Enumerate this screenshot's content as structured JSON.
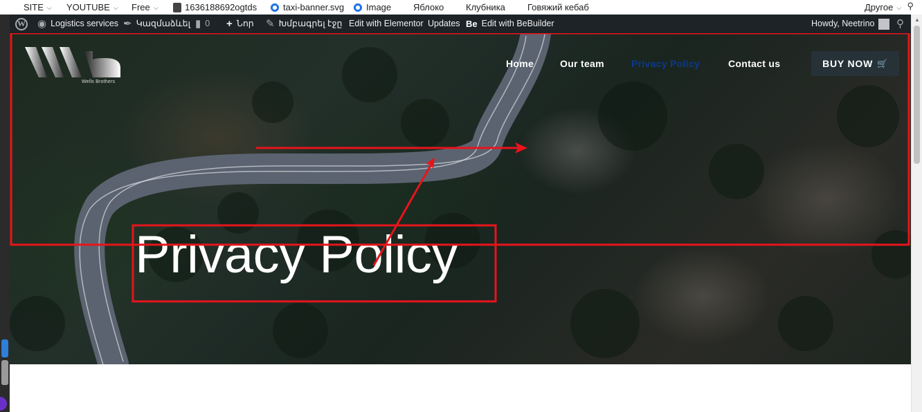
{
  "bookmarks": [
    {
      "label": "SITE",
      "has_menu": true
    },
    {
      "label": "YOUTUBE",
      "has_menu": true
    },
    {
      "label": "Free",
      "has_menu": true
    },
    {
      "label": "1636188692ogtds",
      "icon": "hr-icon"
    },
    {
      "label": "taxi-banner.svg",
      "icon": "chrome-icon"
    },
    {
      "label": "Image",
      "icon": "chrome-icon"
    },
    {
      "label": "Яблоко"
    },
    {
      "label": "Клубника"
    },
    {
      "label": "Говяжий кебаб"
    },
    {
      "label": "Другое",
      "has_menu": true
    }
  ],
  "adminbar": {
    "site_name": "Logistics services",
    "customize": "Կազմաձևել",
    "comments_count": "0",
    "new": "Նոր",
    "edit_page": "Խմբագրել էջը",
    "edit_elementor": "Edit with Elementor",
    "updates": "Updates",
    "bebuilder_prefix": "Be",
    "edit_bebuilder": "Edit with BeBuilder",
    "howdy": "Howdy, Neetrino"
  },
  "site": {
    "logo_text": "Wells Brothers",
    "nav": [
      {
        "label": "Home",
        "active": false
      },
      {
        "label": "Our team",
        "active": false
      },
      {
        "label": "Privacy Policy",
        "active": true
      },
      {
        "label": "Contact us",
        "active": false
      }
    ],
    "buy_button": "BUY NOW",
    "hero_title": "Privacy Policy"
  },
  "colors": {
    "admin_bar": "#1d2327",
    "active_nav": "#0a3a8a",
    "buy_button_bg": "#263238",
    "annotation_red": "#e8141b"
  }
}
